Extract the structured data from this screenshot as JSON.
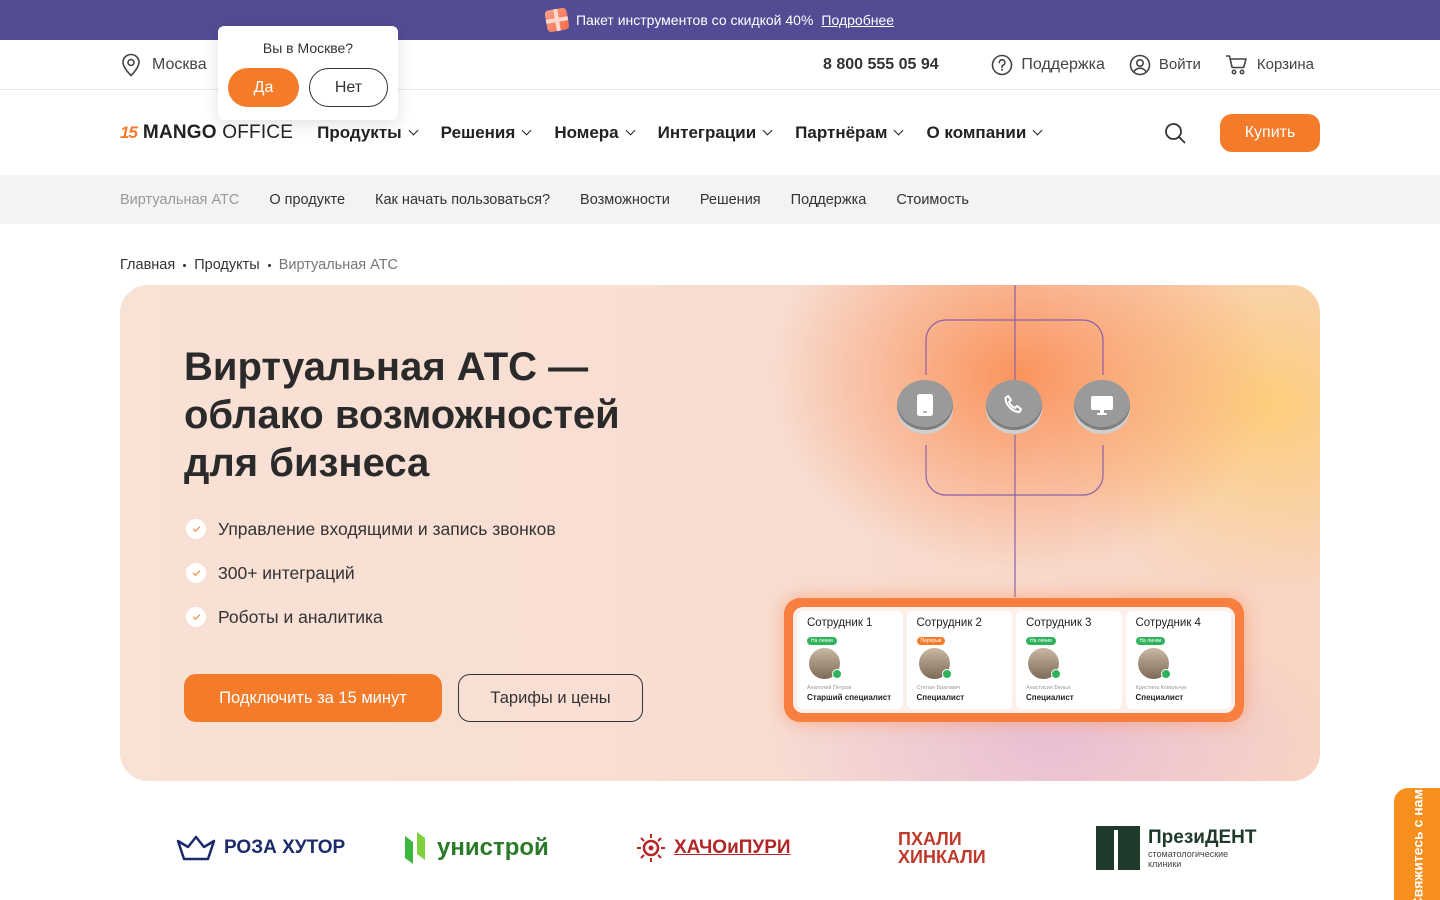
{
  "promo": {
    "text": "Пакет инструментов со скидкой 40%",
    "link": "Подробнее"
  },
  "top": {
    "city": "Москва",
    "phone": "8 800 555 05 94",
    "support": "Поддержка",
    "login": "Войти",
    "cart": "Корзина"
  },
  "city_popup": {
    "question": "Вы в Москве?",
    "yes": "Да",
    "no": "Нет"
  },
  "logo": {
    "mark": "15",
    "brand_bold": "MANGO",
    "brand_light": " OFFICE"
  },
  "nav": {
    "items": [
      "Продукты",
      "Решения",
      "Номера",
      "Интеграции",
      "Партнёрам",
      "О компании"
    ],
    "buy": "Купить"
  },
  "subnav": {
    "items": [
      "Виртуальная АТС",
      "О продукте",
      "Как начать пользоваться?",
      "Возможности",
      "Решения",
      "Поддержка",
      "Стоимость"
    ]
  },
  "breadcrumb": {
    "home": "Главная",
    "products": "Продукты",
    "current": "Виртуальная АТС"
  },
  "hero": {
    "title": "Виртуальная АТС — облако возможностей для бизнеса",
    "features": [
      "Управление входящими и запись звонков",
      "300+ интеграций",
      "Роботы и аналитика"
    ],
    "cta_primary": "Подключить за 15 минут",
    "cta_secondary": "Тарифы и цены",
    "icons": [
      "tablet-icon",
      "phone-icon",
      "monitor-icon"
    ]
  },
  "staff": [
    {
      "name": "Сотрудник 1",
      "status": "На линии",
      "status_color": "green",
      "fullname": "Анатолий Петров",
      "role": "Старший специалист"
    },
    {
      "name": "Сотрудник 2",
      "status": "Перерыв",
      "status_color": "orange",
      "fullname": "Степан Брагович",
      "role": "Специалист"
    },
    {
      "name": "Сотрудник 3",
      "status": "На линии",
      "status_color": "green",
      "fullname": "Анастасия Белых",
      "role": "Специалист"
    },
    {
      "name": "Сотрудник 4",
      "status": "На линии",
      "status_color": "green",
      "fullname": "Кристина Ковальчук",
      "role": "Специалист"
    }
  ],
  "clients": {
    "roza": "РОЗА ХУТОР",
    "unistroy": "унистрой",
    "hacho": "ХАЧОиПУРИ",
    "phali_1": "ПХАЛИ",
    "phali_2": "ХИНКАЛИ",
    "president": "ПрезиДЕНТ",
    "president_sub_1": "стоматологические",
    "president_sub_2": "клиники"
  },
  "contact_tab": "Свяжитесь с нами",
  "colors": {
    "accent": "#f47b2a",
    "promo_bg": "#524c95"
  }
}
